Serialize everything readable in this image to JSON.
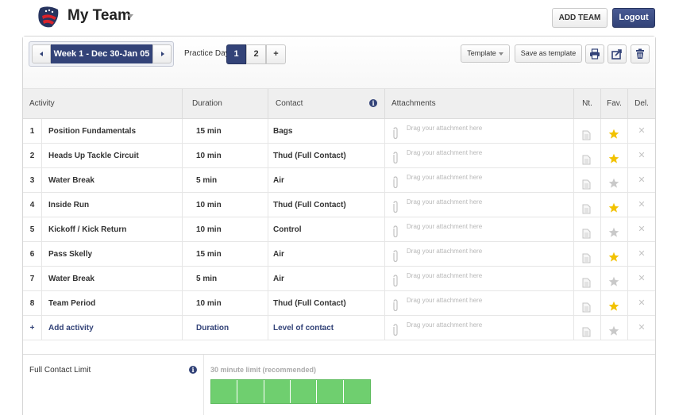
{
  "header": {
    "team_name": "My Team",
    "add_team_label": "ADD TEAM",
    "logout_label": "Logout"
  },
  "toolbar": {
    "week_label": "Week 1 - Dec 30-Jan 05",
    "practice_day_label": "Practice Day",
    "days": [
      "1",
      "2",
      "+"
    ],
    "active_day": "1",
    "template_label": "Template",
    "save_template_label": "Save as template",
    "icons": [
      "print-icon",
      "share-icon",
      "trash-icon"
    ]
  },
  "table": {
    "columns": [
      "Activity",
      "Duration",
      "Contact",
      "Attachments",
      "Nt.",
      "Fav.",
      "Del."
    ],
    "attachment_placeholder": "Drag your attachment here",
    "rows": [
      {
        "num": "1",
        "activity": "Position Fundamentals",
        "duration": "15 min",
        "contact": "Bags",
        "fav": true
      },
      {
        "num": "2",
        "activity": "Heads Up Tackle Circuit",
        "duration": "10 min",
        "contact": "Thud (Full Contact)",
        "fav": true
      },
      {
        "num": "3",
        "activity": "Water Break",
        "duration": "5 min",
        "contact": "Air",
        "fav": false
      },
      {
        "num": "4",
        "activity": "Inside Run",
        "duration": "10 min",
        "contact": "Thud (Full Contact)",
        "fav": true
      },
      {
        "num": "5",
        "activity": "Kickoff / Kick Return",
        "duration": "10 min",
        "contact": "Control",
        "fav": false
      },
      {
        "num": "6",
        "activity": "Pass Skelly",
        "duration": "15 min",
        "contact": "Air",
        "fav": true
      },
      {
        "num": "7",
        "activity": "Water Break",
        "duration": "5 min",
        "contact": "Air",
        "fav": false
      },
      {
        "num": "8",
        "activity": "Team Period",
        "duration": "10 min",
        "contact": "Thud (Full Contact)",
        "fav": true
      }
    ],
    "add_row": {
      "num": "+",
      "activity": "Add activity",
      "duration": "Duration",
      "contact": "Level of contact"
    }
  },
  "limit": {
    "label": "Full Contact Limit",
    "recommendation": "30 minute limit (recommended)",
    "segments": 6,
    "filled_segments": 6
  },
  "colors": {
    "brand": "#334378",
    "star_on": "#f2c200",
    "star_off": "#c9c9c9",
    "limit_fill": "#6fcf6f"
  }
}
